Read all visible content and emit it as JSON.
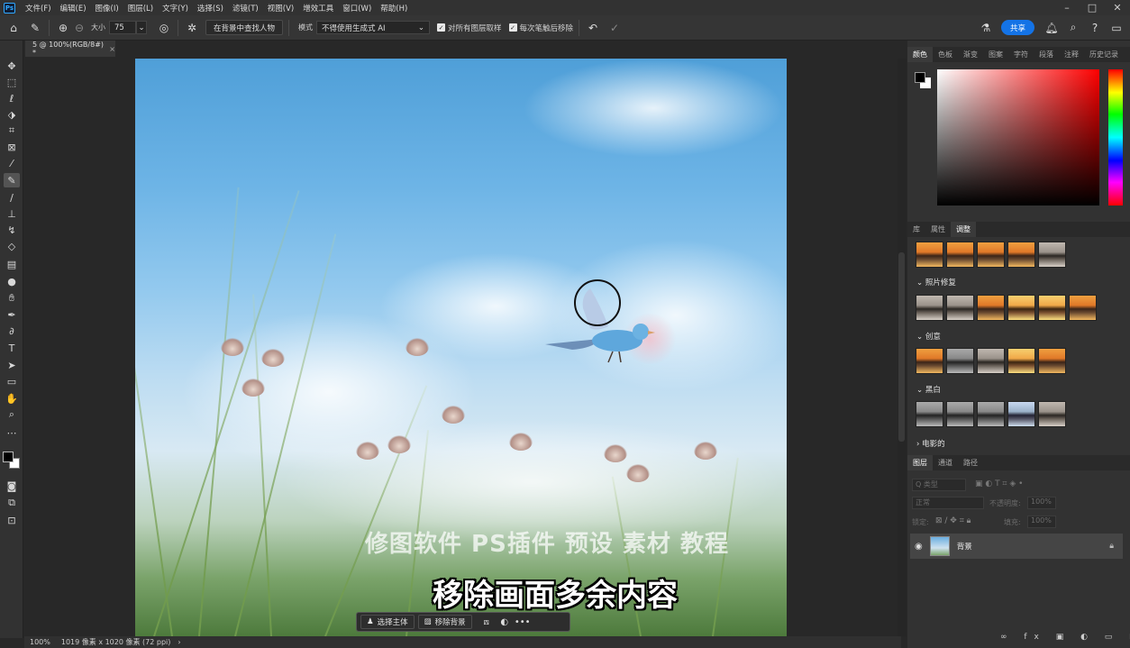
{
  "app": {
    "logo": "Ps"
  },
  "menu": {
    "items": [
      "文件(F)",
      "编辑(E)",
      "图像(I)",
      "图层(L)",
      "文字(Y)",
      "选择(S)",
      "滤镜(T)",
      "视图(V)",
      "增效工具",
      "窗口(W)",
      "帮助(H)"
    ],
    "window_controls": [
      "–",
      "□",
      "✕"
    ]
  },
  "options": {
    "size_label": "大小",
    "size_value": "75",
    "find_people_button": "在背景中查找人物",
    "mode_label": "模式",
    "mode_value": "不得使用生成式 AI",
    "sample_all_layers": "对所有图层取样",
    "remove_after_stroke": "每次笔触后移除",
    "share_button": "共享"
  },
  "document": {
    "tab_title": "5 @ 100%(RGB/8#) *",
    "tab_close": "×"
  },
  "canvas": {
    "watermark": "修图软件 PS插件 预设 素材 教程",
    "subtitle": "移除画面多余内容"
  },
  "taskbar": {
    "select_subject": "选择主体",
    "remove_background": "移除背景",
    "more": "•••"
  },
  "status": {
    "zoom": "100%",
    "dimensions": "1019 像素 x 1020 像素 (72 ppi)",
    "arrow": "›"
  },
  "color_panel": {
    "tabs": [
      "颜色",
      "色板",
      "渐变",
      "图案",
      "字符",
      "段落",
      "注释",
      "历史记录"
    ],
    "foreground": "#000000",
    "background": "#ffffff"
  },
  "adjust_panel": {
    "tabs": [
      "库",
      "属性",
      "调整"
    ],
    "sections": [
      "照片修复",
      "创意",
      "黑白",
      "电影的"
    ]
  },
  "layers_panel": {
    "tabs": [
      "图层",
      "通道",
      "路径"
    ],
    "filter_placeholder": "Q 类型",
    "blend_mode": "正常",
    "opacity_label": "不透明度:",
    "opacity_value": "100%",
    "lock_label": "锁定:",
    "fill_label": "填充:",
    "fill_value": "100%",
    "layer_name": "背景"
  }
}
